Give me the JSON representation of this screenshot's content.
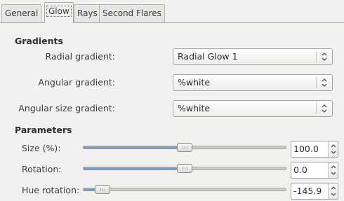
{
  "tabs": [
    {
      "label": "General",
      "active": false
    },
    {
      "label": "Glow",
      "active": true
    },
    {
      "label": "Rays",
      "active": false
    },
    {
      "label": "Second Flares",
      "active": false
    }
  ],
  "gradients": {
    "heading": "Gradients",
    "radial": {
      "label": "Radial gradient:",
      "value": "Radial Glow 1"
    },
    "angular": {
      "label": "Angular gradient:",
      "value": "%white"
    },
    "angular_size": {
      "label": "Angular size gradient:",
      "value": "%white"
    }
  },
  "parameters": {
    "heading": "Parameters",
    "size": {
      "label": "Size (%):",
      "value": "100.0",
      "slider_fraction": 0.5
    },
    "rotation": {
      "label": "Rotation:",
      "value": "0.0",
      "slider_fraction": 0.5
    },
    "hue_rotation": {
      "label": "Hue rotation:",
      "value": "-145.9",
      "slider_fraction": 0.095
    }
  },
  "colors": {
    "accent": "#4a86cf"
  },
  "icons": {
    "combo_arrows": "updown-chevron-icon",
    "spin_arrows": "spin-updown-icon"
  }
}
